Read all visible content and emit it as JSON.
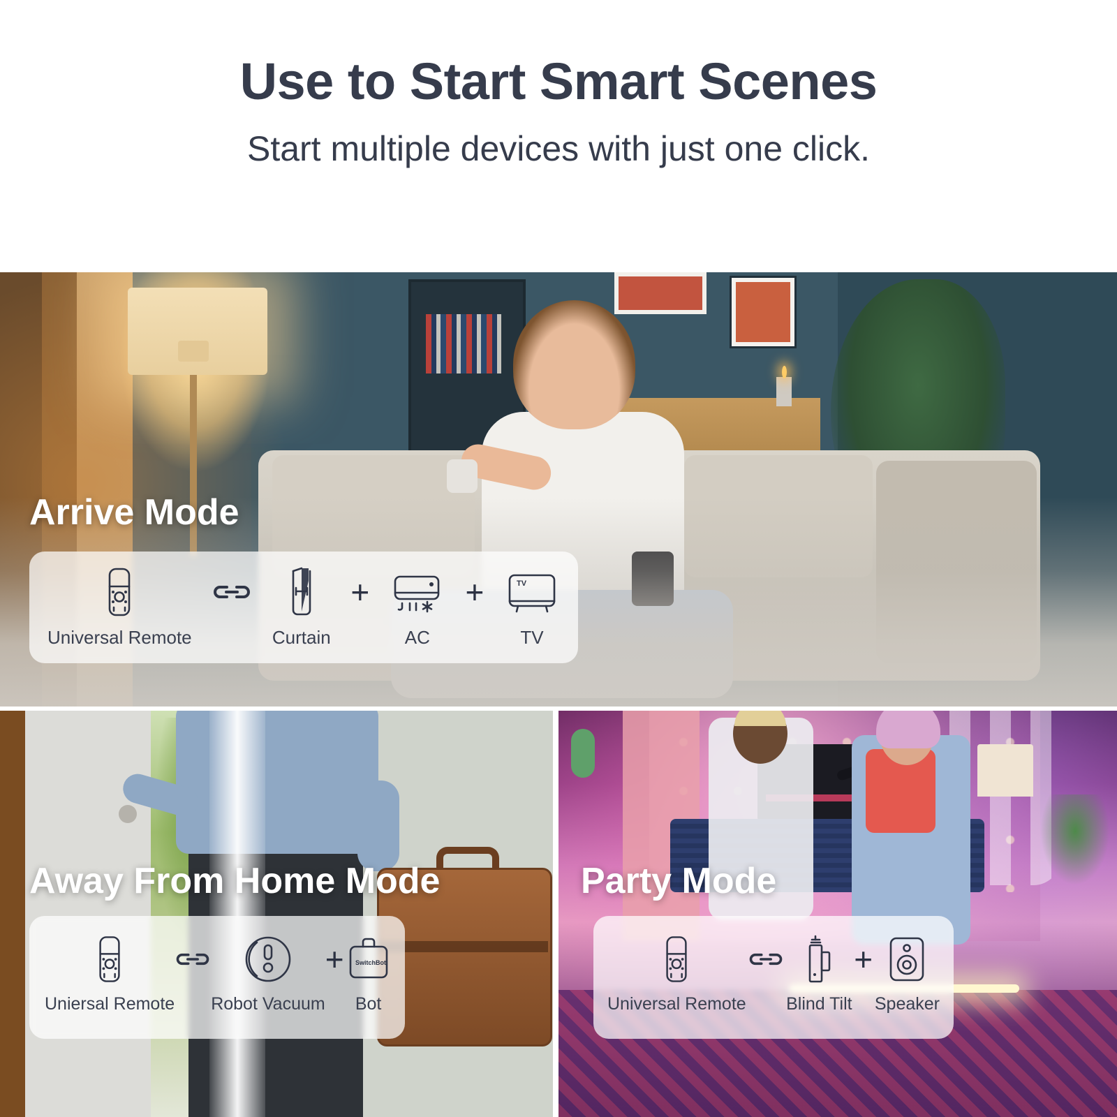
{
  "header": {
    "title": "Use to Start Smart Scenes",
    "subtitle": "Start multiple devices with just one click."
  },
  "colors": {
    "heading_text": "#363c4c",
    "card_background": "rgba(255,255,255,0.72)",
    "icon_stroke": "#2f3546",
    "device_label": "#3a4050",
    "mode_label": "#ffffff"
  },
  "scenes": [
    {
      "id": "arrive",
      "label": "Arrive Mode",
      "devices": [
        {
          "name": "Universal Remote",
          "icon": "universal-remote-icon"
        },
        {
          "name": "Curtain",
          "icon": "curtain-icon"
        },
        {
          "name": "AC",
          "icon": "air-conditioner-icon"
        },
        {
          "name": "TV",
          "icon": "tv-icon"
        }
      ],
      "joiners": [
        "link",
        "plus",
        "plus"
      ]
    },
    {
      "id": "away",
      "label": "Away From Home Mode",
      "devices": [
        {
          "name": "Uniersal Remote",
          "icon": "universal-remote-icon"
        },
        {
          "name": "Robot Vacuum",
          "icon": "robot-vacuum-icon"
        },
        {
          "name": "Bot",
          "icon": "switchbot-bot-icon"
        }
      ],
      "joiners": [
        "link",
        "plus"
      ]
    },
    {
      "id": "party",
      "label": "Party Mode",
      "devices": [
        {
          "name": "Universal Remote",
          "icon": "universal-remote-icon"
        },
        {
          "name": "Blind Tilt",
          "icon": "blind-tilt-icon"
        },
        {
          "name": "Speaker",
          "icon": "speaker-icon"
        }
      ],
      "joiners": [
        "link",
        "plus"
      ]
    }
  ],
  "glyph_text": {
    "tv": "TV",
    "bot_brand": "SwitchBot",
    "plus": "+"
  }
}
